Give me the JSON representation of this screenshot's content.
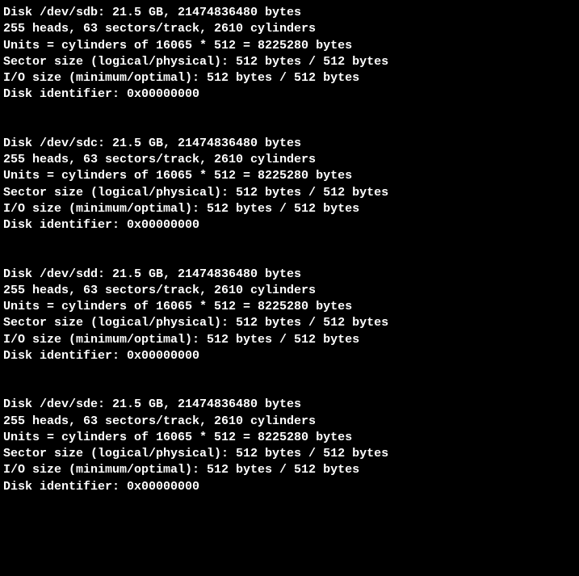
{
  "disks": [
    {
      "line1": "Disk /dev/sdb: 21.5 GB, 21474836480 bytes",
      "line2": "255 heads, 63 sectors/track, 2610 cylinders",
      "line3": "Units = cylinders of 16065 * 512 = 8225280 bytes",
      "line4": "Sector size (logical/physical): 512 bytes / 512 bytes",
      "line5": "I/O size (minimum/optimal): 512 bytes / 512 bytes",
      "line6": "Disk identifier: 0x00000000"
    },
    {
      "line1": "Disk /dev/sdc: 21.5 GB, 21474836480 bytes",
      "line2": "255 heads, 63 sectors/track, 2610 cylinders",
      "line3": "Units = cylinders of 16065 * 512 = 8225280 bytes",
      "line4": "Sector size (logical/physical): 512 bytes / 512 bytes",
      "line5": "I/O size (minimum/optimal): 512 bytes / 512 bytes",
      "line6": "Disk identifier: 0x00000000"
    },
    {
      "line1": "Disk /dev/sdd: 21.5 GB, 21474836480 bytes",
      "line2": "255 heads, 63 sectors/track, 2610 cylinders",
      "line3": "Units = cylinders of 16065 * 512 = 8225280 bytes",
      "line4": "Sector size (logical/physical): 512 bytes / 512 bytes",
      "line5": "I/O size (minimum/optimal): 512 bytes / 512 bytes",
      "line6": "Disk identifier: 0x00000000"
    },
    {
      "line1": "Disk /dev/sde: 21.5 GB, 21474836480 bytes",
      "line2": "255 heads, 63 sectors/track, 2610 cylinders",
      "line3": "Units = cylinders of 16065 * 512 = 8225280 bytes",
      "line4": "Sector size (logical/physical): 512 bytes / 512 bytes",
      "line5": "I/O size (minimum/optimal): 512 bytes / 512 bytes",
      "line6": "Disk identifier: 0x00000000"
    }
  ]
}
